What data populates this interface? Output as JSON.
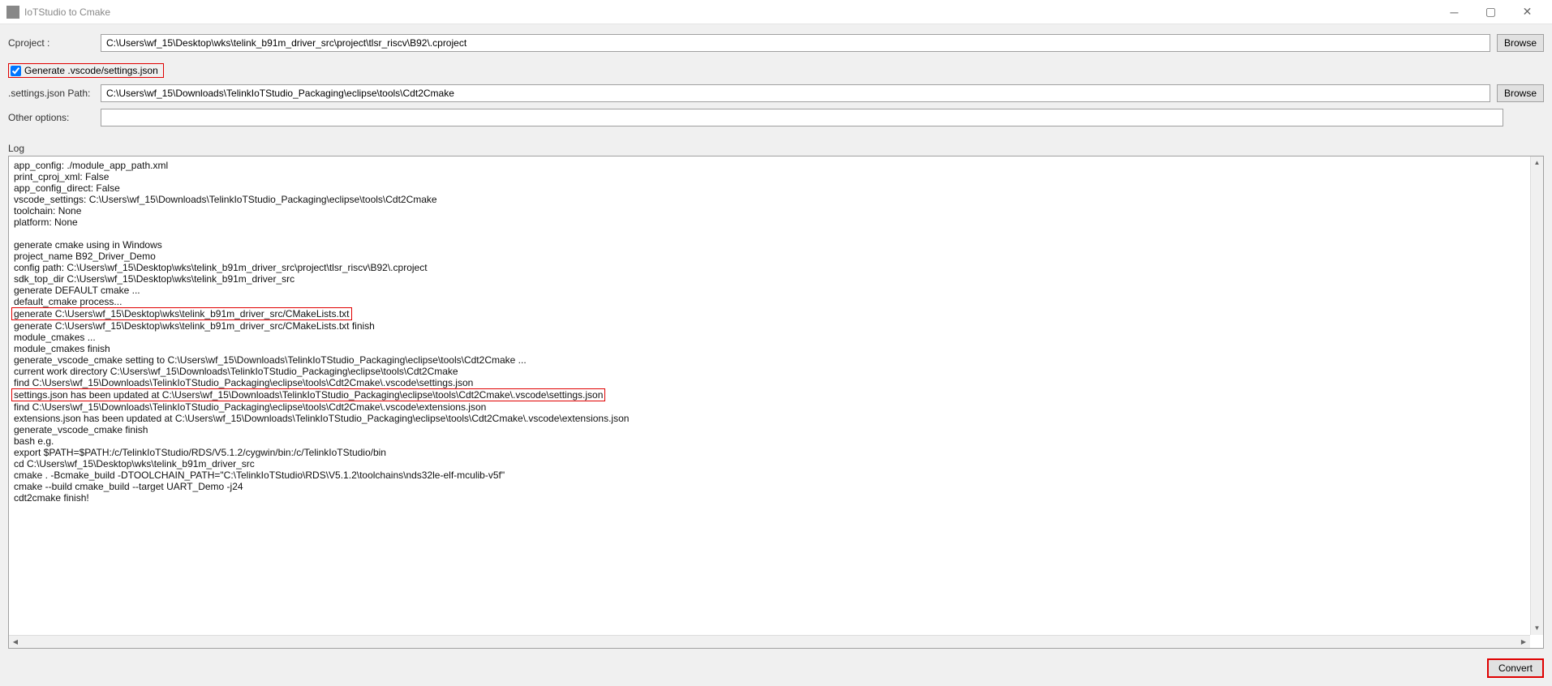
{
  "window": {
    "title": "IoTStudio to Cmake"
  },
  "form": {
    "cproject_label": "Cproject :",
    "cproject_value": "C:\\Users\\wf_15\\Desktop\\wks\\telink_b91m_driver_src\\project\\tlsr_riscv\\B92\\.cproject",
    "browse_label": "Browse",
    "checkbox_label": "Generate .vscode/settings.json",
    "checkbox_checked": true,
    "settings_path_label": ".settings.json Path:",
    "settings_path_value": "C:\\Users\\wf_15\\Downloads\\TelinkIoTStudio_Packaging\\eclipse\\tools\\Cdt2Cmake",
    "other_options_label": "Other options:",
    "other_options_value": ""
  },
  "log": {
    "label": "Log",
    "lines": [
      {
        "text": "app_config: ./module_app_path.xml",
        "hl": false
      },
      {
        "text": "print_cproj_xml: False",
        "hl": false
      },
      {
        "text": "app_config_direct: False",
        "hl": false
      },
      {
        "text": "vscode_settings: C:\\Users\\wf_15\\Downloads\\TelinkIoTStudio_Packaging\\eclipse\\tools\\Cdt2Cmake",
        "hl": false
      },
      {
        "text": "toolchain: None",
        "hl": false
      },
      {
        "text": "platform: None",
        "hl": false
      },
      {
        "text": "",
        "hl": false
      },
      {
        "text": "generate cmake using in Windows",
        "hl": false
      },
      {
        "text": "project_name B92_Driver_Demo",
        "hl": false
      },
      {
        "text": "config path: C:\\Users\\wf_15\\Desktop\\wks\\telink_b91m_driver_src\\project\\tlsr_riscv\\B92\\.cproject",
        "hl": false
      },
      {
        "text": "sdk_top_dir  C:\\Users\\wf_15\\Desktop\\wks\\telink_b91m_driver_src",
        "hl": false
      },
      {
        "text": "generate DEFAULT cmake ...",
        "hl": false
      },
      {
        "text": "default_cmake process...",
        "hl": false
      },
      {
        "text": "generate C:\\Users\\wf_15\\Desktop\\wks\\telink_b91m_driver_src/CMakeLists.txt",
        "hl": true
      },
      {
        "text": "generate C:\\Users\\wf_15\\Desktop\\wks\\telink_b91m_driver_src/CMakeLists.txt finish",
        "hl": false
      },
      {
        "text": "module_cmakes ...",
        "hl": false
      },
      {
        "text": "module_cmakes finish",
        "hl": false
      },
      {
        "text": "generate_vscode_cmake setting to C:\\Users\\wf_15\\Downloads\\TelinkIoTStudio_Packaging\\eclipse\\tools\\Cdt2Cmake ...",
        "hl": false
      },
      {
        "text": "current work directory C:\\Users\\wf_15\\Downloads\\TelinkIoTStudio_Packaging\\eclipse\\tools\\Cdt2Cmake",
        "hl": false
      },
      {
        "text": "find C:\\Users\\wf_15\\Downloads\\TelinkIoTStudio_Packaging\\eclipse\\tools\\Cdt2Cmake\\.vscode\\settings.json",
        "hl": false
      },
      {
        "text": "settings.json has been updated at C:\\Users\\wf_15\\Downloads\\TelinkIoTStudio_Packaging\\eclipse\\tools\\Cdt2Cmake\\.vscode\\settings.json",
        "hl": true
      },
      {
        "text": "find C:\\Users\\wf_15\\Downloads\\TelinkIoTStudio_Packaging\\eclipse\\tools\\Cdt2Cmake\\.vscode\\extensions.json",
        "hl": false
      },
      {
        "text": "extensions.json has been updated at C:\\Users\\wf_15\\Downloads\\TelinkIoTStudio_Packaging\\eclipse\\tools\\Cdt2Cmake\\.vscode\\extensions.json",
        "hl": false
      },
      {
        "text": "generate_vscode_cmake finish",
        "hl": false
      },
      {
        "text": "bash e.g.",
        "hl": false
      },
      {
        "text": "  export $PATH=$PATH:/c/TelinkIoTStudio/RDS/V5.1.2/cygwin/bin:/c/TelinkIoTStudio/bin",
        "hl": false
      },
      {
        "text": "  cd C:\\Users\\wf_15\\Desktop\\wks\\telink_b91m_driver_src",
        "hl": false
      },
      {
        "text": "  cmake . -Bcmake_build -DTOOLCHAIN_PATH=\"C:\\TelinkIoTStudio\\RDS\\V5.1.2\\toolchains\\nds32le-elf-mculib-v5f\"",
        "hl": false
      },
      {
        "text": "  cmake --build cmake_build --target  UART_Demo  -j24",
        "hl": false
      },
      {
        "text": "cdt2cmake finish!",
        "hl": false
      }
    ]
  },
  "buttons": {
    "convert_label": "Convert"
  }
}
